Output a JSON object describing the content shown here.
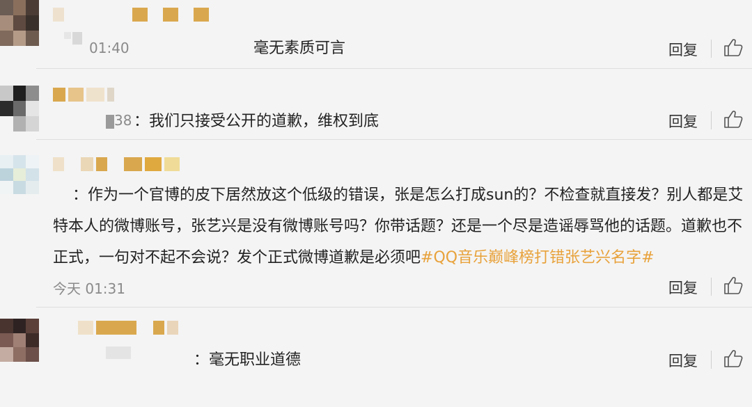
{
  "comments": [
    {
      "text": "毫无素质可言",
      "time": "01:40",
      "reply_label": "回复"
    },
    {
      "text": "：我们只接受公开的道歉，维权到底",
      "time_fragment": "38",
      "reply_label": "回复"
    },
    {
      "text_main": "：作为一个官博的皮下居然放这个低级的错误，张是怎么打成sun的？不检查就直接发？别人都是艾特本人的微博账号，张艺兴是没有微博账号吗？你带话题？还是一个尽是造谣辱骂他的话题。道歉也不正式，一句对不起不会说？发个正式微博道歉是必须吧",
      "hashtag": "#QQ音乐巅峰榜打错张艺兴名字#",
      "time": "今天 01:31",
      "reply_label": "回复"
    },
    {
      "text": "：毫无职业道德",
      "reply_label": "回复"
    }
  ],
  "icons": {
    "like": "thumbs-up-icon"
  },
  "colors": {
    "background": "#f4f4f4",
    "hashtag": "#e8a23b",
    "time": "#8a8a8a",
    "masked_name": "#d9a84e"
  }
}
